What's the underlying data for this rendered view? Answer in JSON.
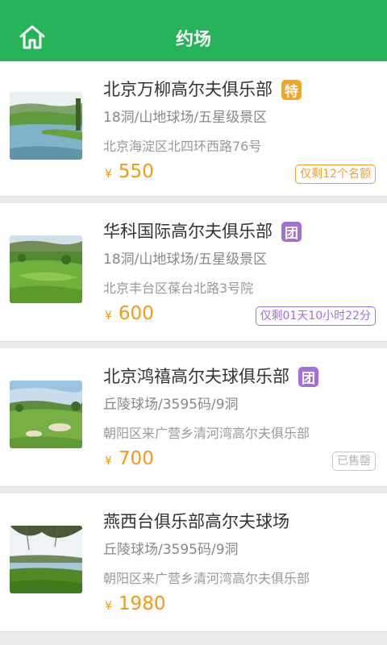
{
  "header": {
    "title": "约场",
    "home_icon": "home-icon"
  },
  "colors": {
    "brand": "#26b35a",
    "price": "#f29b13",
    "tag_special": "#f5a623",
    "tag_group": "#a36fd8"
  },
  "clubs": [
    {
      "name": "北京万柳高尔夫俱乐部",
      "tag": "特",
      "info1": "18洞/山地球场/五星级景区",
      "address": "北京海淀区北四环西路76号",
      "currency": "¥",
      "price": "550",
      "badge": "仅剩12个名额"
    },
    {
      "name": "华科国际高尔夫俱乐部",
      "tag": "团",
      "info1": "18洞/山地球场/五星级景区",
      "address": "北京丰台区葆台北路3号院",
      "currency": "¥",
      "price": "600",
      "badge": "仅剩01天10小时22分"
    },
    {
      "name": "北京鸿禧高尔夫球俱乐部",
      "tag": "团",
      "info1": "丘陵球场/3595码/9洞",
      "address": "朝阳区来广营乡清河湾高尔夫俱乐部",
      "currency": "¥",
      "price": "700",
      "badge": "已售罄"
    },
    {
      "name": "燕西台俱乐部高尔夫球场",
      "info1": "丘陵球场/3595码/9洞",
      "address": "朝阳区来广营乡清河湾高尔夫俱乐部",
      "currency": "¥",
      "price": "1980"
    }
  ]
}
